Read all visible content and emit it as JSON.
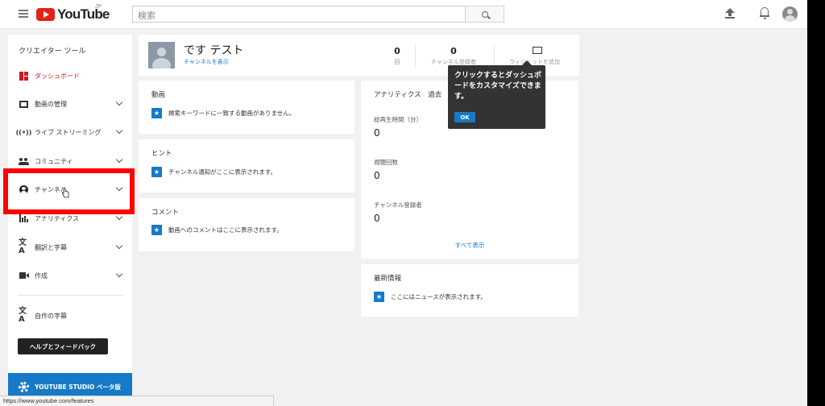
{
  "header": {
    "logo_text": "YouTube",
    "logo_region": "JP",
    "search_placeholder": "検索"
  },
  "sidebar": {
    "title": "クリエイター ツール",
    "items": [
      {
        "label": "ダッシュボード",
        "icon": "dashboard-icon",
        "active": true
      },
      {
        "label": "動画の管理",
        "icon": "video-manager-icon"
      },
      {
        "label": "ライブ ストリーミング",
        "icon": "live-icon"
      },
      {
        "label": "コミュニティ",
        "icon": "community-icon"
      },
      {
        "label": "チャンネル",
        "icon": "channel-icon"
      },
      {
        "label": "アナリティクス",
        "icon": "analytics-icon"
      },
      {
        "label": "翻訳と字幕",
        "icon": "translate-icon"
      },
      {
        "label": "作成",
        "icon": "create-icon"
      }
    ],
    "own_subtitles": "自作の字幕",
    "help_button": "ヘルプとフィードバック",
    "studio_button": "YOUTUBE STUDIO ベータ版"
  },
  "channel": {
    "name": "です テスト",
    "view_link": "チャンネルを表示",
    "views_count": "0",
    "views_label": "回",
    "subscribers_count": "0",
    "subscribers_label": "チャンネル登録者",
    "add_widget": "ウィジェットを追加"
  },
  "videos": {
    "title": "動画",
    "empty": "検索キーワードに一致する動画がありません。"
  },
  "hints": {
    "title": "ヒント",
    "empty": "チャンネル通知がここに表示されます。"
  },
  "comments": {
    "title": "コメント",
    "empty": "動画へのコメントはここに表示されます。"
  },
  "analytics": {
    "title": "アナリティクス",
    "title_suffix": "過去",
    "watch_time_label": "総再生時間（分）",
    "watch_time_value": "0",
    "views_label": "視聴回数",
    "views_value": "0",
    "subscribers_label": "チャンネル登録者",
    "subscribers_value": "0",
    "show_all": "すべて表示"
  },
  "news": {
    "title": "最新情報",
    "empty": "ここにはニュースが表示されます。"
  },
  "tooltip": {
    "text": "クリックするとダッシュボードをカスタマイズできます。",
    "ok": "OK"
  },
  "status_bar_url": "https://www.youtube.com/features",
  "colors": {
    "brand_red": "#e62117",
    "accent_blue": "#167ac6",
    "highlight_red": "#ff0000"
  }
}
